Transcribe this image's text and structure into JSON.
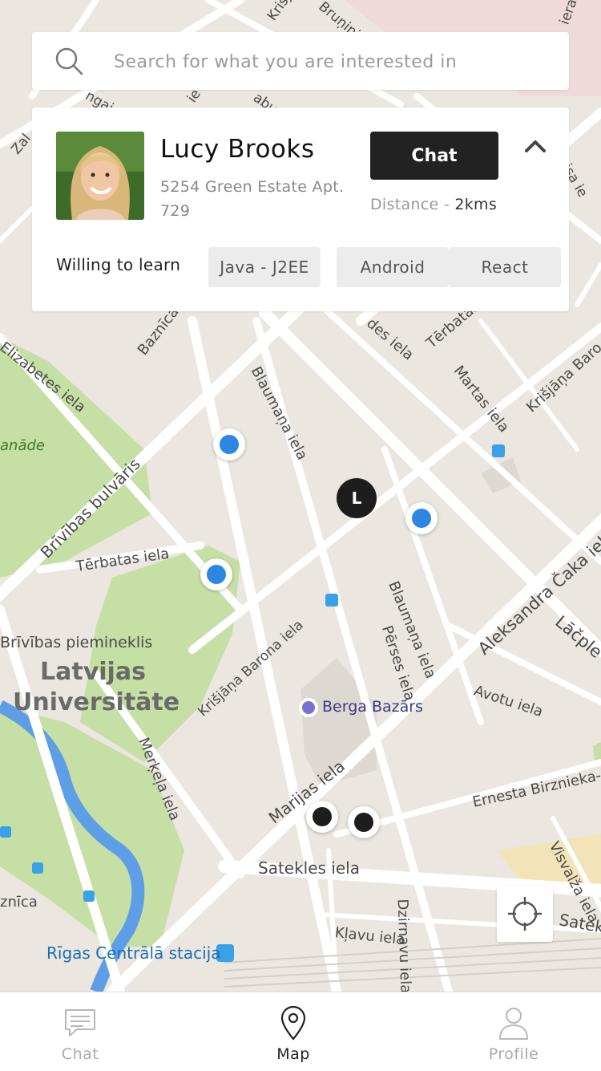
{
  "search": {
    "placeholder": "Search for what you are interested in"
  },
  "profile_card": {
    "name": "Lucy Brooks",
    "address": "5254 Green Estate Apt. 729",
    "chat_label": "Chat",
    "distance_label": "Distance - ",
    "distance_value": "2kms",
    "willing_label": "Willing to learn",
    "tags": [
      "Java - J2EE",
      "Android",
      "React"
    ]
  },
  "map": {
    "marker_letter": "L",
    "labels": {
      "elizabetes": "Elizabetes iela",
      "baznicas": "Baznīcas",
      "blaumana1": "Blaumaņa iela",
      "desiela": "des iela",
      "terbatas_top": "Tērbatas",
      "martas": "Martas iela",
      "krisjana_top": "Krišjāņa Baro",
      "brivibas_bulv": "Brīvības bulvāris",
      "anade": "anāde",
      "terbatas": "Tērbatas iela",
      "brivibas_pieminek": "Brīvības piemineklis",
      "latvijas": "Latvijas",
      "universitate": "Universitāte",
      "krisjana_barona": "Krišjāņa Barona iela",
      "blaumana2": "Blaumaņa iela",
      "perses": "Pērses iela",
      "aleksandra": "Aleksandra Čaka iela",
      "lacple": "Lāčple",
      "avotu": "Avotu iela",
      "berga": "Berga Bazārs",
      "merkela": "Merķeļa iela",
      "marijas": "Marijas iela",
      "ernesta": "Ernesta Birznieka-U",
      "visvalza": "Visvalža iela",
      "satekles": "Satekles iela",
      "satek": "Satek",
      "znica": "znīca",
      "klavu": "Kļavu iela",
      "dzirnavu": "Dzirnavu iela",
      "centrala": "Rīgas Centrālā stacija",
      "krisjan_top": "Krišja",
      "bruninieku": "Bruņini",
      "labu": "abu",
      "ngai": "ngai",
      "ie": "ie",
      "zal": "Zal",
      "isaie": "isa ie",
      "iera": "iera i"
    },
    "colors": {
      "park": "#c6dfa4",
      "water": "#5e9ee6",
      "road": "#ffffff",
      "ground": "#ebe6df"
    }
  },
  "tabs": [
    {
      "label": "Chat",
      "icon": "chat-bubble-icon",
      "active": false
    },
    {
      "label": "Map",
      "icon": "map-pin-icon",
      "active": true
    },
    {
      "label": "Profile",
      "icon": "person-icon",
      "active": false
    }
  ]
}
